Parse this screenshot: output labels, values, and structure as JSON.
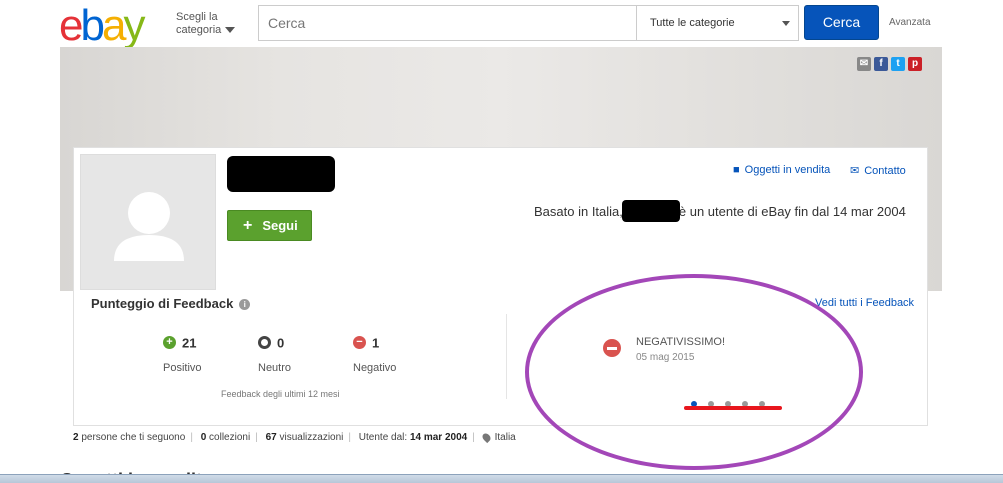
{
  "header": {
    "logo": {
      "e": "e",
      "b": "b",
      "a": "a",
      "y": "y"
    },
    "shop_by_category": {
      "line1": "Scegli la",
      "line2": "categoria"
    },
    "search": {
      "placeholder": "Cerca",
      "category": "Tutte le categorie",
      "button": "Cerca"
    },
    "advanced": "Avanzata"
  },
  "share_icons": [
    {
      "name": "email-icon",
      "color": "#888888",
      "glyph": "✉"
    },
    {
      "name": "facebook-icon",
      "color": "#3b5998",
      "glyph": "f"
    },
    {
      "name": "twitter-icon",
      "color": "#1da1f2",
      "glyph": "t"
    },
    {
      "name": "pinterest-icon",
      "color": "#cb2027",
      "glyph": "p"
    }
  ],
  "profile": {
    "follow_button": "Segui",
    "items_for_sale": "Oggetti in vendita",
    "contact": "Contatto",
    "based_in_prefix": "Basato in Italia,",
    "member_since_suffix": "è un utente di eBay fin dal 14 mar 2004"
  },
  "feedback": {
    "title": "Punteggio di Feedback",
    "see_all": "Vedi tutti i Feedback",
    "ratings": [
      {
        "count": "21",
        "label": "Positivo",
        "color": "#5ba12e",
        "symbol": "+"
      },
      {
        "count": "0",
        "label": "Neutro",
        "color": "#444444",
        "symbol": ""
      },
      {
        "count": "1",
        "label": "Negativo",
        "color": "#d9534f",
        "symbol": "−"
      }
    ],
    "window_note": "Feedback degli ultimi 12 mesi",
    "latest": {
      "text": "NEGATIVISSIMO!",
      "date": "05 mag 2015"
    },
    "carousel": {
      "pages": 5,
      "active": 1
    }
  },
  "stats": {
    "followers_count": "2",
    "followers_label": "persone che ti seguono",
    "collections_count": "0",
    "collections_label": "collezioni",
    "views_count": "67",
    "views_label": "visualizzazioni",
    "member_since_label": "Utente dal:",
    "member_since_value": "14 mar 2004",
    "location": "Italia"
  },
  "next_section_heading": "Oggetti in vendita",
  "colors": {
    "accent_blue": "#0654ba",
    "follow_green": "#5ba12e",
    "annotation_ellipse": "#a347b8",
    "annotation_underline": "#e8161d"
  }
}
